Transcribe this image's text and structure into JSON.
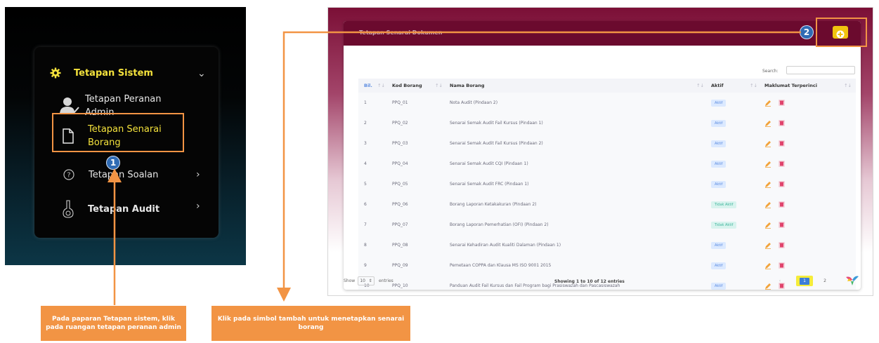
{
  "sidebar": {
    "items": [
      {
        "label": "Tetapan Sistem",
        "icon": "gear-icon"
      },
      {
        "label_line1": "Tetapan Peranan",
        "label_line2": "Admin",
        "icon": "user-check-icon"
      },
      {
        "label_line1": "Tetapan Senarai",
        "label_line2": "Borang",
        "icon": "document-icon"
      },
      {
        "label": "Tetapan Soalan",
        "icon": "question-circle-icon"
      },
      {
        "label": "Tetapan Audit",
        "icon": "audit-icon"
      }
    ]
  },
  "card": {
    "title": "Tetapan Senarai Dokumen",
    "search_label": "Search:",
    "search_value": ""
  },
  "table": {
    "headers": [
      "Bil.",
      "Kod Borang",
      "Nama Borang",
      "Aktif",
      "Maklumat Terperinci"
    ],
    "rows": [
      {
        "bil": "1",
        "kod": "PPQ_01",
        "nama": "Nota Audit (Pindaan 2)",
        "aktif": "Aktif"
      },
      {
        "bil": "2",
        "kod": "PPQ_02",
        "nama": "Senarai Semak Audit Fail Kursus (Pindaan 1)",
        "aktif": "Aktif"
      },
      {
        "bil": "3",
        "kod": "PPQ_03",
        "nama": "Senarai Semak Audit Fail Kursus (Pindaan 2)",
        "aktif": "Aktif"
      },
      {
        "bil": "4",
        "kod": "PPQ_04",
        "nama": "Senarai Semak Audit CQI (Pindaan 1)",
        "aktif": "Aktif"
      },
      {
        "bil": "5",
        "kod": "PPQ_05",
        "nama": "Senarai Semak Audit FRC (Pindaan 1)",
        "aktif": "Aktif"
      },
      {
        "bil": "6",
        "kod": "PPQ_06",
        "nama": "Borang Laporan Ketakakuran (Pindaan 2)",
        "aktif": "Tidak Aktif"
      },
      {
        "bil": "7",
        "kod": "PPQ_07",
        "nama": "Borang Laporan Pemerhatian (OFI) (Pindaan 2)",
        "aktif": "Tidak Aktif"
      },
      {
        "bil": "8",
        "kod": "PPQ_08",
        "nama": "Senarai Kehadiran Audit Kualiti Dalaman (Pindaan 1)",
        "aktif": "Aktif"
      },
      {
        "bil": "9",
        "kod": "PPQ_09",
        "nama": "Pemetaan COPPA dan Klausa MS ISO 9001 2015",
        "aktif": "Aktif"
      },
      {
        "bil": "10",
        "kod": "PPQ_10",
        "nama": "Panduan Audit Fail Kursus dan Fail Program bagi Prasiswazah dan Pascasiswazah",
        "aktif": "Aktif"
      }
    ]
  },
  "footer": {
    "show": "Show",
    "entries_value": "10",
    "entries": "entries",
    "showing": "Showing 1 to 10 of 12 entries",
    "prev": "‹",
    "page1": "1",
    "page2": "2"
  },
  "annotations": {
    "step1": "1",
    "step2": "2",
    "callout1": "Pada paparan Tetapan sistem, klik pada ruangan tetapan peranan admin",
    "callout2": "Klik pada simbol tambah untuk menetapkan senarai borang"
  },
  "colors": {
    "accent_yellow": "#f4e23c",
    "header_maroon": "#6b0a2e",
    "annotation_orange": "#f29444",
    "step_blue": "#2f6bb4"
  }
}
